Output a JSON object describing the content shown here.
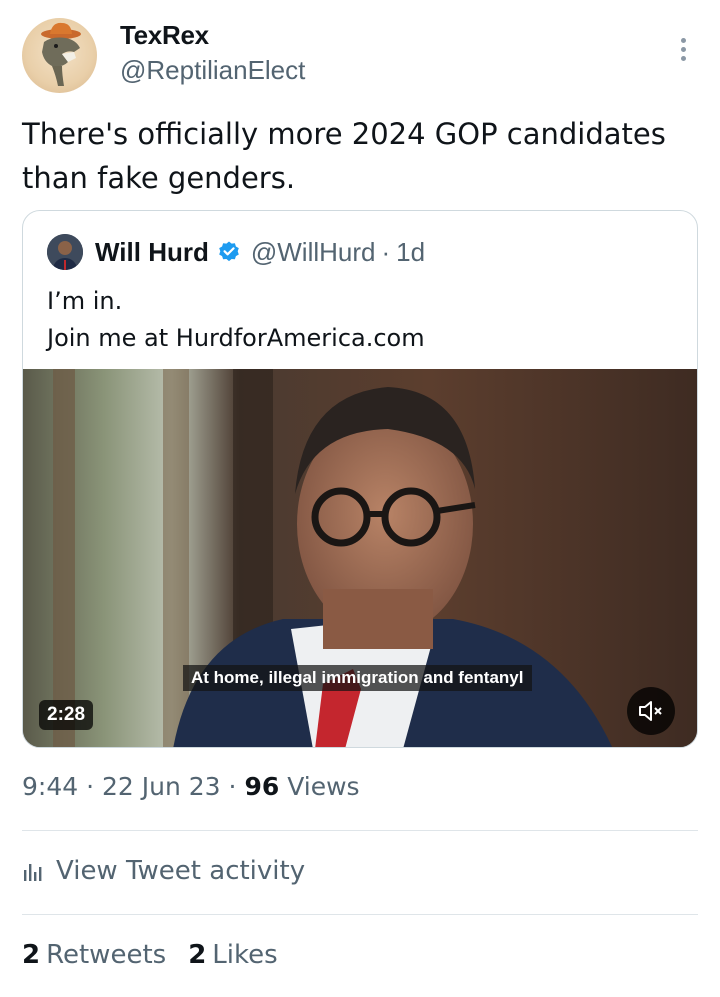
{
  "author": {
    "display_name": "TexRex",
    "handle": "@ReptilianElect",
    "avatar_icon": "dinosaur-cowboy-hat-avatar"
  },
  "tweet": {
    "text": "There's officially more 2024 GOP candidates than fake genders."
  },
  "quoted_tweet": {
    "display_name": "Will Hurd",
    "handle": "@WillHurd",
    "separator": "·",
    "time": "1d",
    "line1": "I’m in.",
    "line2": "Join me at HurdforAmerica.com",
    "verified_color": "#1d9bf0",
    "video": {
      "caption": "At home, illegal immigration and fentanyl",
      "duration": "2:28",
      "mute_icon": "speaker-muted-icon"
    }
  },
  "meta": {
    "time": "9:44",
    "sep1": "·",
    "date": "22 Jun 23",
    "sep2": "·",
    "views_count": "96",
    "views_label": "Views"
  },
  "activity": {
    "label": "View Tweet activity",
    "icon": "bar-chart-icon"
  },
  "stats": {
    "retweets_count": "2",
    "retweets_label": "Retweets",
    "likes_count": "2",
    "likes_label": "Likes"
  },
  "colors": {
    "text_primary": "#0f1419",
    "text_secondary": "#536471",
    "border": "#cfd9de"
  }
}
